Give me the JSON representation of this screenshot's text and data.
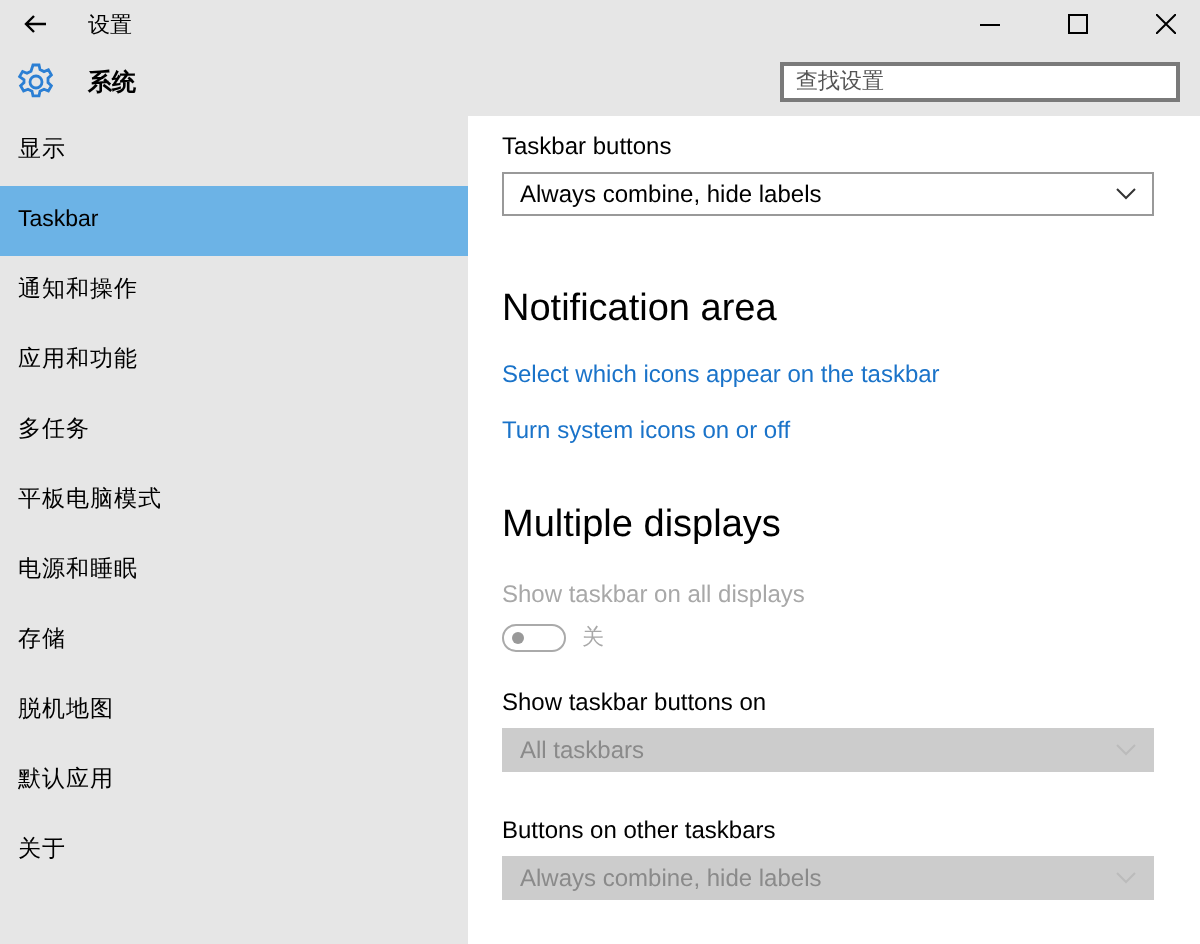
{
  "window": {
    "title": "设置"
  },
  "header": {
    "title": "系统",
    "search": {
      "placeholder": "查找设置"
    }
  },
  "sidebar": {
    "items": [
      {
        "label": "显示",
        "selected": false
      },
      {
        "label": "Taskbar",
        "selected": true
      },
      {
        "label": "通知和操作",
        "selected": false
      },
      {
        "label": "应用和功能",
        "selected": false
      },
      {
        "label": "多任务",
        "selected": false
      },
      {
        "label": "平板电脑模式",
        "selected": false
      },
      {
        "label": "电源和睡眠",
        "selected": false
      },
      {
        "label": "存储",
        "selected": false
      },
      {
        "label": "脱机地图",
        "selected": false
      },
      {
        "label": "默认应用",
        "selected": false
      },
      {
        "label": "关于",
        "selected": false
      }
    ]
  },
  "content": {
    "items": [
      {
        "kind": "dropdown",
        "label": "Taskbar buttons",
        "value": "Always combine, hide labels",
        "disabled": false
      },
      {
        "kind": "heading",
        "text": "Notification area"
      },
      {
        "kind": "link",
        "text": "Select which icons appear on the taskbar"
      },
      {
        "kind": "link",
        "text": "Turn system icons on or off"
      },
      {
        "kind": "heading",
        "text": "Multiple displays"
      },
      {
        "kind": "toggle",
        "label": "Show taskbar on all displays",
        "state": "关",
        "on": false,
        "disabled": true
      },
      {
        "kind": "dropdown",
        "label": "Show taskbar buttons on",
        "value": "All taskbars",
        "disabled": true
      },
      {
        "kind": "dropdown",
        "label": "Buttons on other taskbars",
        "value": "Always combine, hide labels",
        "disabled": true
      }
    ]
  }
}
